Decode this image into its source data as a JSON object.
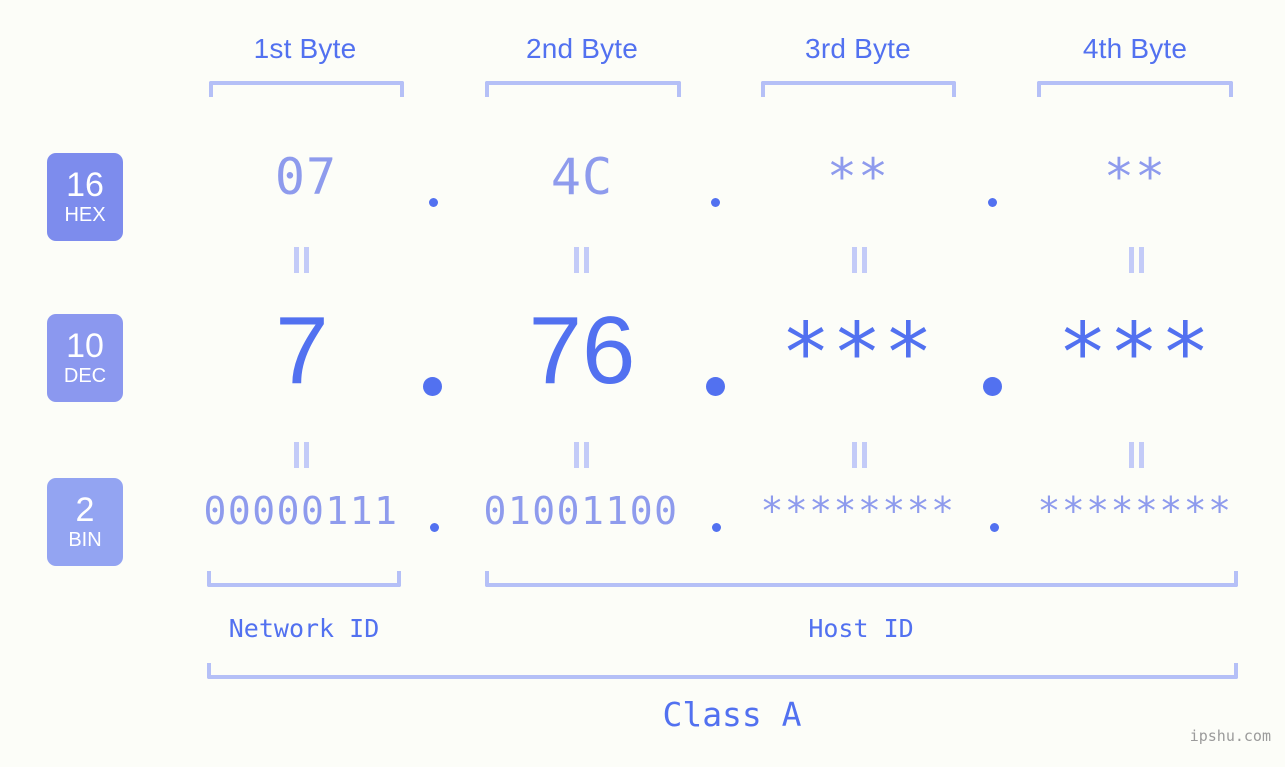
{
  "background_color": "#fcfdf8",
  "accent_color": "#5271f0",
  "muted_color": "#8e9bed",
  "bracket_color": "#b5c0f7",
  "headers": {
    "byte1": "1st Byte",
    "byte2": "2nd Byte",
    "byte3": "3rd Byte",
    "byte4": "4th Byte"
  },
  "badges": [
    {
      "number": "16",
      "name": "HEX",
      "color": "#7d8ced"
    },
    {
      "number": "10",
      "name": "DEC",
      "color": "#8b98ef"
    },
    {
      "number": "2",
      "name": "BIN",
      "color": "#93a4f2"
    }
  ],
  "rows": {
    "hex": {
      "b1": "07",
      "b2": "4C",
      "b3": "**",
      "b4": "**"
    },
    "dec": {
      "b1": "7",
      "b2": "76",
      "b3": "***",
      "b4": "***"
    },
    "bin": {
      "b1": "00000111",
      "b2": "01001100",
      "b3": "********",
      "b4": "********"
    }
  },
  "separator": ".",
  "equals_symbol": "=",
  "segments": {
    "network_id": "Network ID",
    "host_id": "Host ID",
    "class": "Class A"
  },
  "watermark": "ipshu.com"
}
